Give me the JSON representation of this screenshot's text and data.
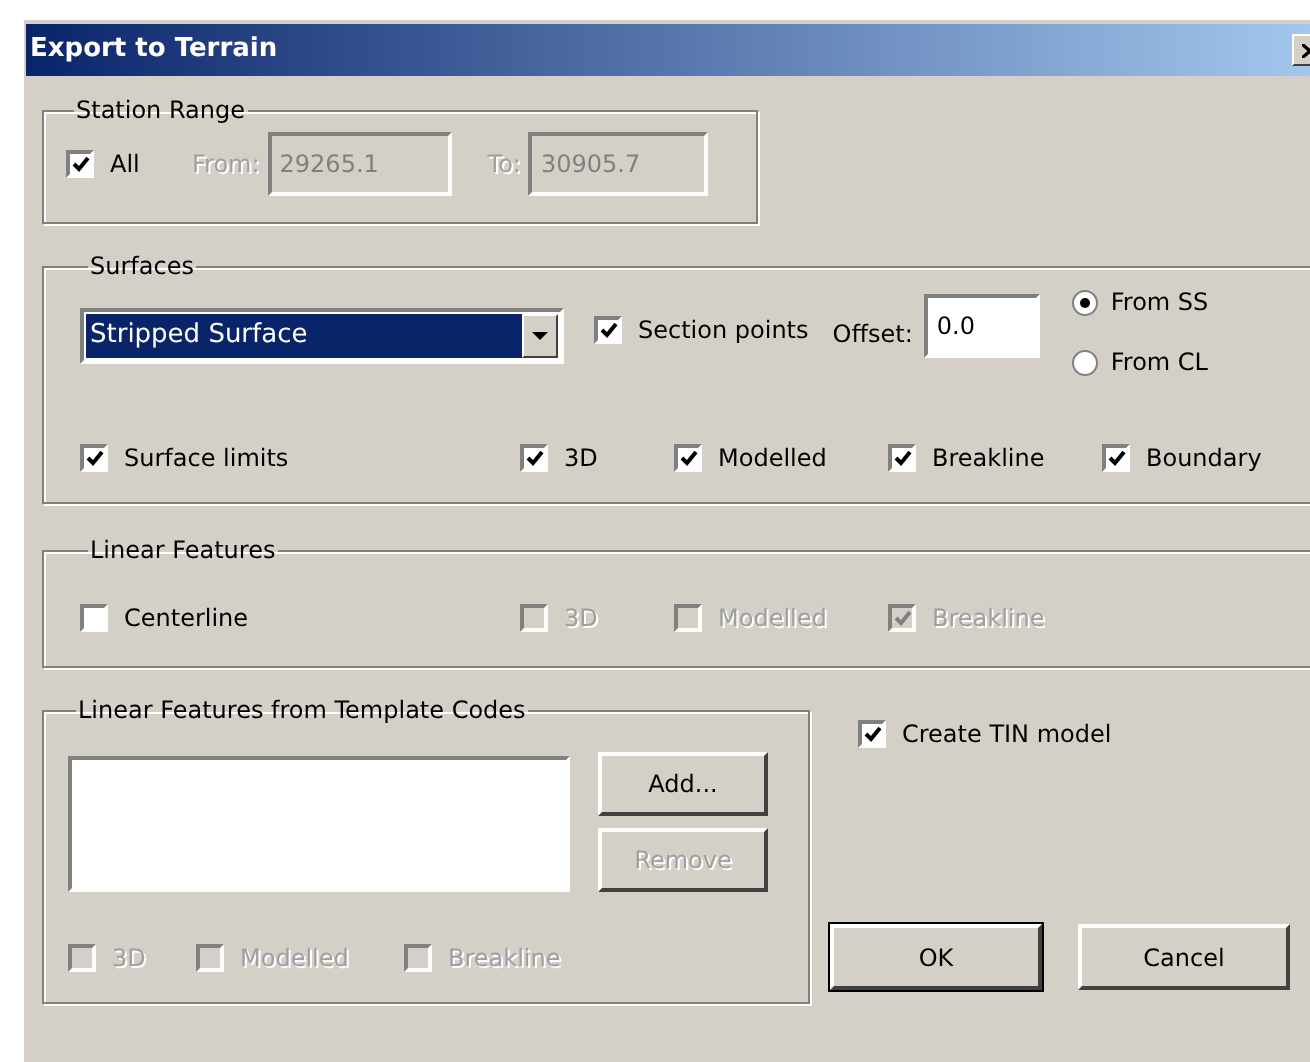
{
  "window": {
    "title": "Export to Terrain"
  },
  "station_range": {
    "title": "Station Range",
    "all": {
      "label": "All",
      "checked": true
    },
    "from": {
      "label": "From:",
      "value": "29265.1",
      "disabled": true
    },
    "to": {
      "label": "To:",
      "value": "30905.7",
      "disabled": true
    }
  },
  "surfaces": {
    "title": "Surfaces",
    "surface_select": {
      "value": "Stripped Surface"
    },
    "section_points": {
      "label": "Section points",
      "checked": true
    },
    "offset": {
      "label": "Offset:",
      "value": "0.0"
    },
    "origin": [
      {
        "label": "From SS",
        "selected": true
      },
      {
        "label": "From CL",
        "selected": false
      }
    ],
    "options": [
      {
        "label": "Surface limits",
        "checked": true,
        "disabled": false
      },
      {
        "label": "3D",
        "checked": true,
        "disabled": false
      },
      {
        "label": "Modelled",
        "checked": true,
        "disabled": false
      },
      {
        "label": "Breakline",
        "checked": true,
        "disabled": false
      },
      {
        "label": "Boundary",
        "checked": true,
        "disabled": false
      }
    ]
  },
  "linear_features": {
    "title": "Linear Features",
    "options": [
      {
        "label": "Centerline",
        "checked": false,
        "disabled": false
      },
      {
        "label": "3D",
        "checked": false,
        "disabled": true
      },
      {
        "label": "Modelled",
        "checked": false,
        "disabled": true
      },
      {
        "label": "Breakline",
        "checked": true,
        "disabled": true
      }
    ]
  },
  "template_codes": {
    "title": "Linear Features from Template Codes",
    "buttons": [
      {
        "label": "Add...",
        "disabled": false
      },
      {
        "label": "Remove",
        "disabled": true
      }
    ],
    "options": [
      {
        "label": "3D",
        "checked": false,
        "disabled": true
      },
      {
        "label": "Modelled",
        "checked": false,
        "disabled": true
      },
      {
        "label": "Breakline",
        "checked": false,
        "disabled": true
      }
    ]
  },
  "create_tin": {
    "label": "Create TIN model",
    "checked": true
  },
  "buttons": [
    {
      "label": "OK",
      "default": true
    },
    {
      "label": "Cancel",
      "default": false
    }
  ]
}
